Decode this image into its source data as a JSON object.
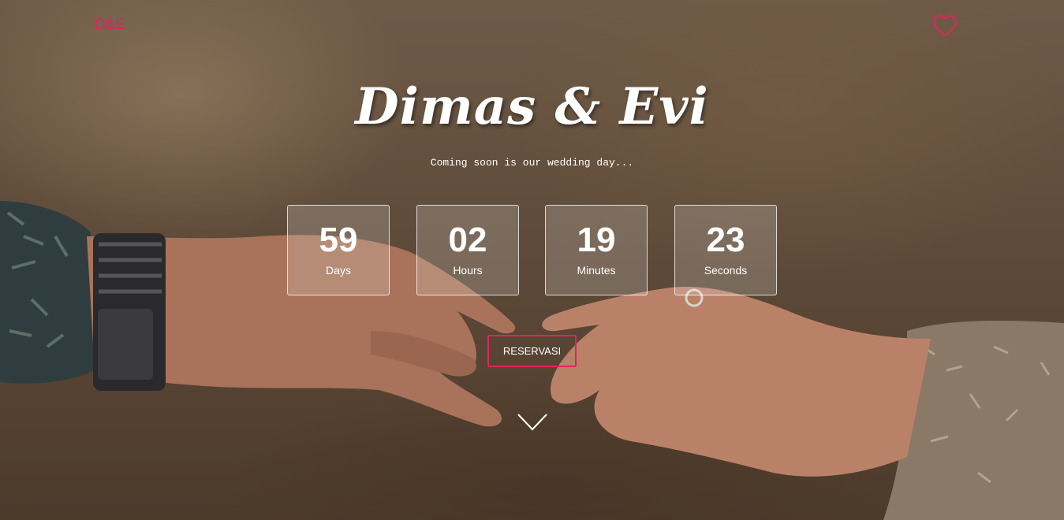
{
  "nav": {
    "brand": "D&E",
    "heart_icon": "heart-outline-icon"
  },
  "hero": {
    "title": "Dimas & Evi",
    "subtitle": "Coming soon is our wedding day...",
    "countdown": [
      {
        "value": "59",
        "label": "Days"
      },
      {
        "value": "02",
        "label": "Hours"
      },
      {
        "value": "19",
        "label": "Minutes"
      },
      {
        "value": "23",
        "label": "Seconds"
      }
    ],
    "reserve_label": "RESERVASI",
    "scroll_icon": "chevron-down-icon"
  },
  "colors": {
    "accent": "#e0245e",
    "text": "#ffffff"
  }
}
